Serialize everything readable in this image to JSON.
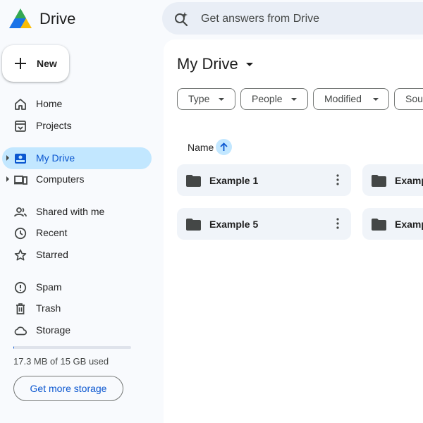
{
  "app": {
    "title": "Drive"
  },
  "search": {
    "placeholder": "Get answers from Drive"
  },
  "new_button": {
    "label": "New"
  },
  "sidebar": {
    "items": [
      {
        "label": "Home",
        "icon": "home-icon"
      },
      {
        "label": "Projects",
        "icon": "projects-icon"
      },
      {
        "label": "My Drive",
        "icon": "my-drive-icon",
        "active": true
      },
      {
        "label": "Computers",
        "icon": "computers-icon"
      },
      {
        "label": "Shared with me",
        "icon": "shared-icon"
      },
      {
        "label": "Recent",
        "icon": "clock-icon"
      },
      {
        "label": "Starred",
        "icon": "star-icon"
      },
      {
        "label": "Spam",
        "icon": "spam-icon"
      },
      {
        "label": "Trash",
        "icon": "trash-icon"
      },
      {
        "label": "Storage",
        "icon": "cloud-icon"
      }
    ]
  },
  "storage": {
    "usage_text": "17.3 MB of 15 GB used",
    "used_fraction": 0.001,
    "button_label": "Get more storage"
  },
  "main": {
    "title": "My Drive",
    "filters": [
      "Type",
      "People",
      "Modified",
      "Sou"
    ],
    "column_header": "Name",
    "sort": "ascending",
    "folders": [
      "Example 1",
      "Examp",
      "Example 5",
      "Examp"
    ]
  },
  "colors": {
    "accent": "#0b57d0",
    "active_nav_bg": "#c2e7ff",
    "card_bg": "#f0f4f9",
    "page_bg": "#f8fafd"
  }
}
